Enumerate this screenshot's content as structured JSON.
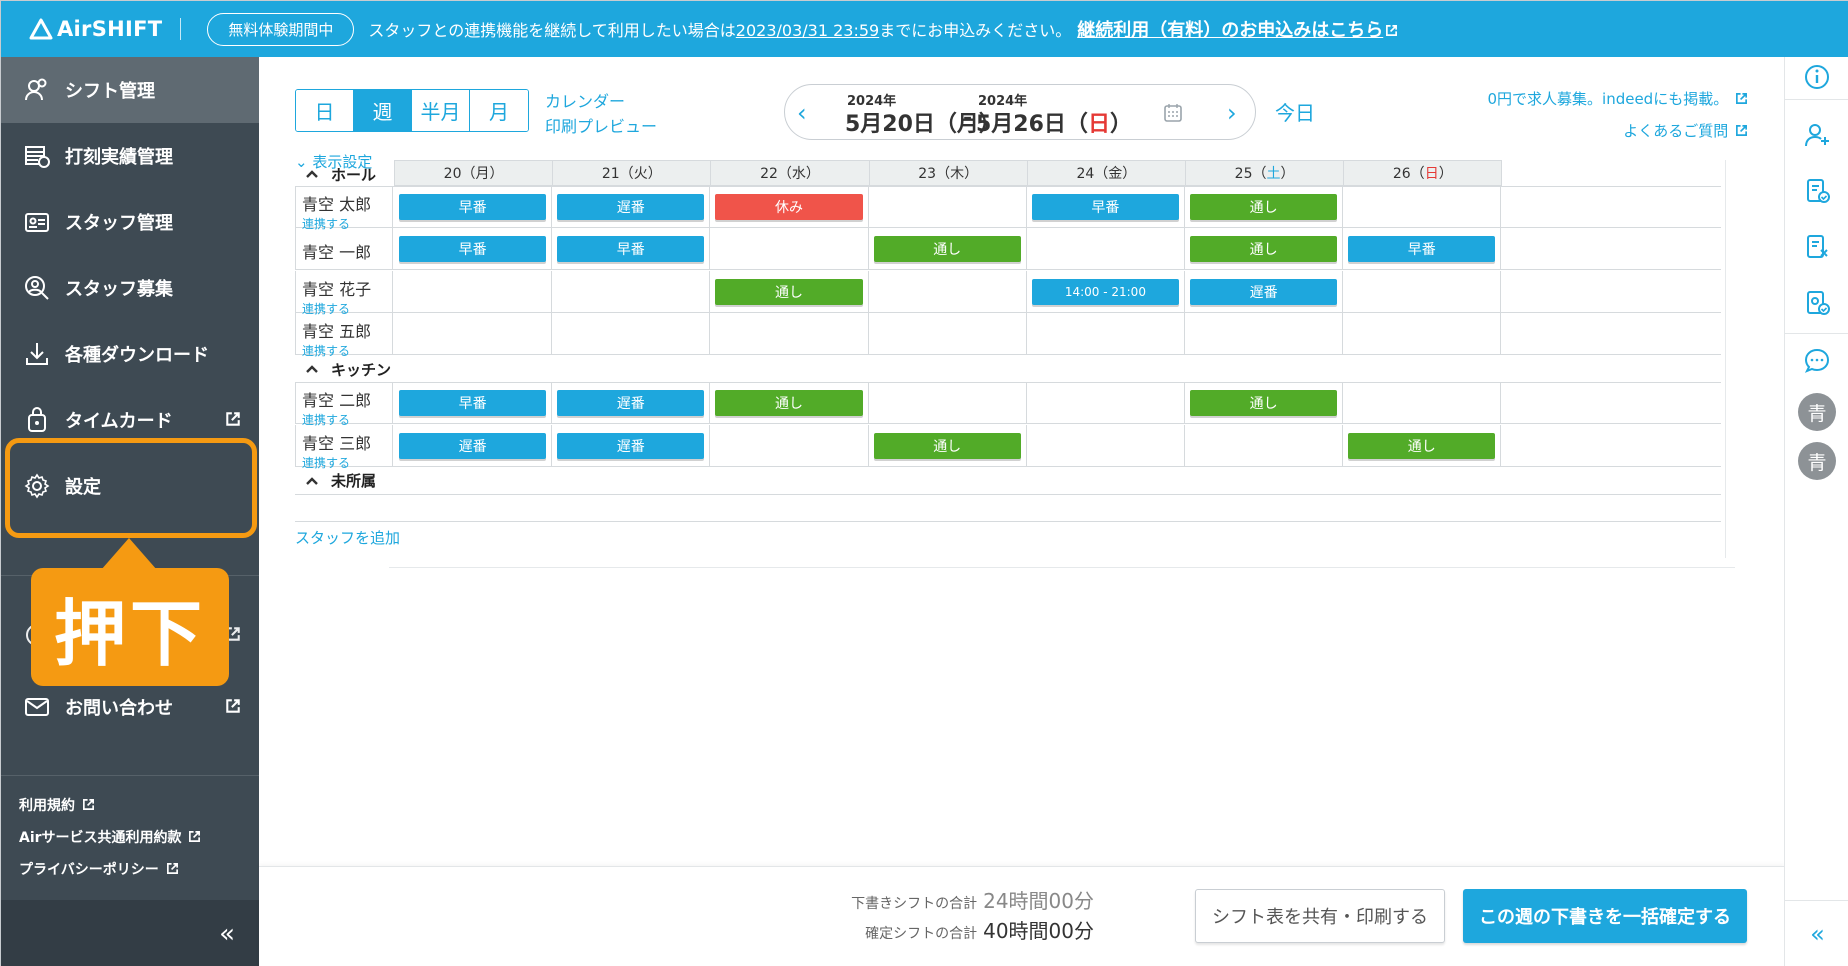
{
  "header": {
    "logo": "AirSHIFT",
    "trial_badge": "無料体験期間中",
    "notice_pre": "スタッフとの連携機能を継続して利用したい場合は",
    "deadline": "2023/03/31 23:59",
    "notice_post": "までにお申込みください。",
    "cta": "継続利用（有料）のお申込みはこちら"
  },
  "sidebar": {
    "items": [
      {
        "label": "シフト管理",
        "icon": "people-icon",
        "active": true
      },
      {
        "label": "打刻実績管理",
        "icon": "timesheet-icon"
      },
      {
        "label": "スタッフ管理",
        "icon": "id-card-icon"
      },
      {
        "label": "スタッフ募集",
        "icon": "recruit-icon"
      },
      {
        "label": "各種ダウンロード",
        "icon": "download-icon"
      },
      {
        "label": "タイムカード",
        "icon": "timecard-icon",
        "external": true
      },
      {
        "label": "設定",
        "icon": "gear-icon",
        "highlighted": true
      },
      {
        "label": "お問い合わせ",
        "icon": "mail-icon",
        "external": true
      }
    ],
    "legal": [
      "利用規約",
      "Airサービス共通利用約款",
      "プライバシーポリシー"
    ],
    "collapse": "«"
  },
  "callout": {
    "label": "押下",
    "color": "#f59a12"
  },
  "toolbar": {
    "views": [
      "日",
      "週",
      "半月",
      "月"
    ],
    "active_view": "週",
    "calendar_link": "カレンダー",
    "print_preview": "印刷プレビュー",
    "start_year": "2024年",
    "start_date": "5月20日（月）",
    "separator": "-",
    "end_year": "2024年",
    "end_date_pre": "5月26日（",
    "end_date_day": "日",
    "end_date_post": "）",
    "prev": "‹",
    "next": "›",
    "today": "今日",
    "recruit_link": "0円で求人募集。indeedにも掲載。",
    "faq_link": "よくあるご質問",
    "display_settings": "表示設定"
  },
  "schedule": {
    "days": [
      {
        "pre": "20（",
        "day": "月",
        "post": "）"
      },
      {
        "pre": "21（",
        "day": "火",
        "post": "）"
      },
      {
        "pre": "22（",
        "day": "水",
        "post": "）"
      },
      {
        "pre": "23（",
        "day": "木",
        "post": "）"
      },
      {
        "pre": "24（",
        "day": "金",
        "post": "）"
      },
      {
        "pre": "25（",
        "day": "土",
        "post": "）"
      },
      {
        "pre": "26（",
        "day": "日",
        "post": "）"
      }
    ],
    "groups": [
      {
        "name": "ホール",
        "staff": [
          {
            "name": "青空 太郎",
            "link": "連携する",
            "shifts": [
              "早番",
              "遅番",
              "休み",
              "",
              "早番",
              "通し",
              ""
            ]
          },
          {
            "name": "青空 一郎",
            "link": "",
            "shifts": [
              "早番",
              "早番",
              "",
              "通し",
              "",
              "通し",
              "早番"
            ]
          },
          {
            "name": "青空 花子",
            "link": "連携する",
            "shifts": [
              "",
              "",
              "通し",
              "",
              "14:00 - 21:00",
              "遅番",
              ""
            ]
          },
          {
            "name": "青空 五郎",
            "link": "連携する",
            "shifts": [
              "",
              "",
              "",
              "",
              "",
              "",
              ""
            ]
          }
        ]
      },
      {
        "name": "キッチン",
        "staff": [
          {
            "name": "青空 二郎",
            "link": "連携する",
            "shifts": [
              "早番",
              "遅番",
              "通し",
              "",
              "",
              "通し",
              ""
            ]
          },
          {
            "name": "青空 三郎",
            "link": "連携する",
            "shifts": [
              "遅番",
              "遅番",
              "",
              "通し",
              "",
              "",
              "通し"
            ]
          }
        ]
      },
      {
        "name": "未所属",
        "staff": []
      }
    ],
    "add_staff": "スタッフを追加",
    "colors": {
      "blue": "#1ea7dd",
      "green": "#52ab28",
      "red": "#f0544a",
      "saturday": "#1ea7dd",
      "sunday": "#e53935"
    }
  },
  "footer": {
    "draft_label": "下書きシフトの合計",
    "draft_value": "24時間00分",
    "confirmed_label": "確定シフトの合計",
    "confirmed_value": "40時間00分",
    "share_button": "シフト表を共有・印刷する",
    "confirm_button": "この週の下書きを一括確定する"
  },
  "rightbar": {
    "icons": [
      "info-icon",
      "add-user-icon",
      "doc-check-icon",
      "doc-x-icon",
      "doc-approve-icon",
      "chat-icon"
    ],
    "avatars": [
      "青",
      "青"
    ],
    "collapse": "«"
  }
}
